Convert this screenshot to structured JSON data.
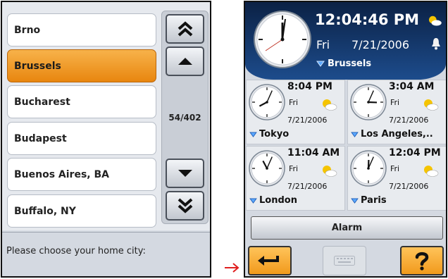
{
  "city_list": {
    "items": [
      {
        "label": "Brno",
        "selected": false
      },
      {
        "label": "Brussels",
        "selected": true
      },
      {
        "label": "Bucharest",
        "selected": false
      },
      {
        "label": "Budapest",
        "selected": false
      },
      {
        "label": "Buenos Aires, BA",
        "selected": false
      },
      {
        "label": "Buffalo, NY",
        "selected": false
      }
    ],
    "counter": "54/402",
    "prompt": "Please choose your home city:"
  },
  "world_clock": {
    "main": {
      "time": "12:04:46 PM",
      "day": "Fri",
      "date": "7/21/2006",
      "city": "Brussels"
    },
    "cities": [
      {
        "time": "8:04 PM",
        "day": "Fri",
        "date": "7/21/2006",
        "city": "Tokyo",
        "hour": 8,
        "minute": 4
      },
      {
        "time": "3:04 AM",
        "day": "Fri",
        "date": "7/21/2006",
        "city": "Los Angeles,..",
        "hour": 3,
        "minute": 4
      },
      {
        "time": "11:04 AM",
        "day": "Fri",
        "date": "7/21/2006",
        "city": "London",
        "hour": 11,
        "minute": 4
      },
      {
        "time": "12:04 PM",
        "day": "Fri",
        "date": "7/21/2006",
        "city": "Paris",
        "hour": 12,
        "minute": 4
      }
    ],
    "alarm_label": "Alarm"
  },
  "colors": {
    "accent_orange": "#f19a1c",
    "header_blue": "#0b2145"
  },
  "icons": [
    "double-up-icon",
    "up-icon",
    "down-icon",
    "double-down-icon",
    "sun-cloud-icon",
    "bell-icon",
    "dropdown-triangle-icon",
    "back-arrow-icon",
    "keyboard-icon",
    "help-icon",
    "transition-arrow-icon"
  ]
}
